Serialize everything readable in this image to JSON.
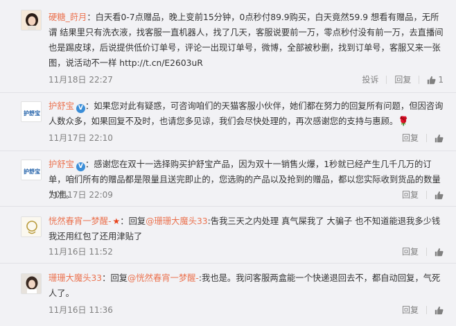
{
  "comments": [
    {
      "username": "硬糖_莳月",
      "text": "：白天看0-7点赠品，晚上变前15分钟，0点秒付89.9购买，白天竟然59.9 想看有赠品，无所谓 结果里只有洗衣液，找客服一直机器人，找了几天，客服说要前一万，零点秒付没有前一万，去直播间也是踢皮球，后说提供低价订单号，评论一出现订单号，微博，全部被秒删，找到订单号，客服又来一张图，说活动不一样 ",
      "url": "http://t.cn/E2603uR",
      "time": "11月18日 22:27",
      "report": "投诉",
      "reply": "回复",
      "likes": "1"
    },
    {
      "username": "护舒宝",
      "avatar_text": "护舒宝",
      "text": "：如果您对此有疑惑，可咨询咱们的天猫客服小伙伴，她们都在努力的回复所有问题，但因咨询人数众多，如果回复不及时，也请您多见谅，我们会尽快处理的，再次感谢您的支持与惠顾。",
      "emoji": "🌹",
      "time": "11月17日 22:10",
      "reply": "回复"
    },
    {
      "username": "护舒宝",
      "avatar_text": "护舒宝",
      "text": "：感谢您在双十一选择购买护舒宝产品，因为双十一销售火爆，1秒就已经产生几千几万的订单，咱们所有的赠品都是限量且送完即止的，您选购的产品以及抢到的赠品，都以您实际收到货品的数量为准。",
      "time": "11月17日 22:09",
      "reply": "回复"
    },
    {
      "username": "恍然春宵一梦醒-",
      "reply_prefix": "：回复",
      "mention": "@珊珊大魔头33",
      "text": ":吿我三天之内处理 真气屎我了 大骗子 也不知道能退我多少钱 我还用红包了还用津贴了",
      "time": "11月16日 11:52",
      "reply": "回复"
    },
    {
      "username": "珊珊大魔头33",
      "reply_prefix": "：回复",
      "mention": "@恍然春宵一梦醒-",
      "text": ":我也是。我问客服两盒能一个快递退回去不，都自动回复，气死人了。",
      "time": "11月16日 11:36",
      "reply": "回复"
    }
  ],
  "colors": {
    "name": "#eb7350",
    "text": "#333333",
    "meta": "#808080",
    "bg": "#f2f2f5"
  }
}
